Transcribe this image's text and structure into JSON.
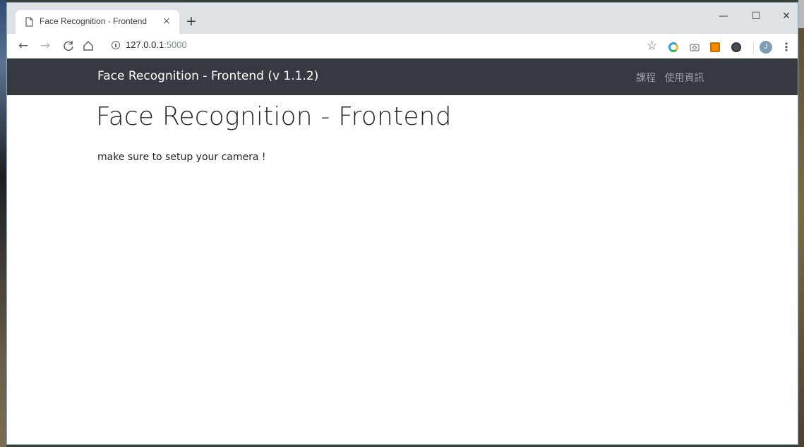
{
  "browser": {
    "tab_title": "Face Recognition - Frontend",
    "tab_close": "×",
    "new_tab": "+",
    "url_host": "127.0.0.1",
    "url_port": ":5000",
    "avatar_initial": "J",
    "window_controls": {
      "minimize": "—",
      "maximize": "☐",
      "close": "✕"
    },
    "icons": {
      "back": "arrow-left-icon",
      "forward": "arrow-right-icon",
      "reload": "reload-icon",
      "home": "home-icon",
      "info": "info-icon",
      "bookmark": "star-icon",
      "extensions": [
        "compass-extension-icon",
        "camera-extension-icon",
        "orange-extension-icon",
        "shield-extension-icon"
      ],
      "menu": "kebab-menu-icon"
    }
  },
  "navbar": {
    "brand": "Face Recognition - Frontend (v 1.1.2)",
    "links": [
      "課程",
      "使用資訊"
    ],
    "background": "#343a40"
  },
  "main": {
    "heading": "Face Recognition - Frontend",
    "message": "make sure to setup your camera !"
  }
}
